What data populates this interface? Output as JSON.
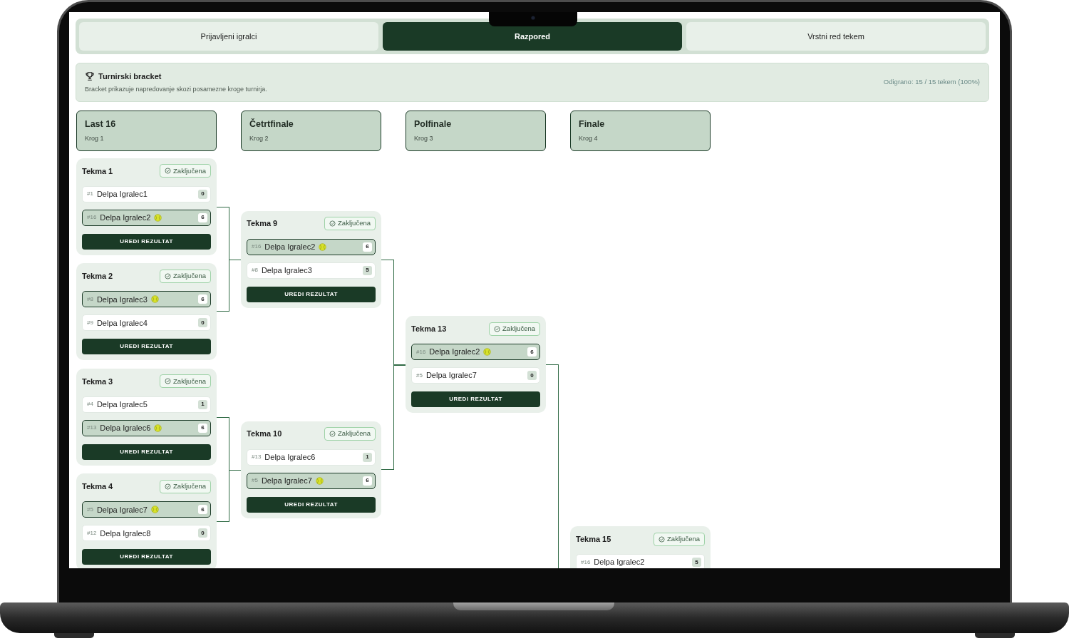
{
  "tabs": [
    {
      "label": "Prijavljeni igralci",
      "selected": false
    },
    {
      "label": "Razpored",
      "selected": true
    },
    {
      "label": "Vrstni red tekem",
      "selected": false
    }
  ],
  "bracket_panel": {
    "title": "Turnirski bracket",
    "description": "Bracket prikazuje napredovanje skozi posamezne kroge turnirja.",
    "progress": "Odigrano: 15 / 15 tekem (100%)"
  },
  "rounds": [
    {
      "title": "Last 16",
      "subtitle": "Krog 1",
      "matches": [
        {
          "title": "Tekma 1",
          "status": "Zaključena",
          "players": [
            {
              "seed": "#1",
              "name": "Delpa Igralec1",
              "score": "0",
              "winner": false
            },
            {
              "seed": "#16",
              "name": "Delpa Igralec2",
              "score": "6",
              "winner": true
            }
          ],
          "button": "UREDI REZULTAT"
        },
        {
          "title": "Tekma 2",
          "status": "Zaključena",
          "players": [
            {
              "seed": "#8",
              "name": "Delpa Igralec3",
              "score": "6",
              "winner": true
            },
            {
              "seed": "#9",
              "name": "Delpa Igralec4",
              "score": "0",
              "winner": false
            }
          ],
          "button": "UREDI REZULTAT"
        },
        {
          "title": "Tekma 3",
          "status": "Zaključena",
          "players": [
            {
              "seed": "#4",
              "name": "Delpa Igralec5",
              "score": "1",
              "winner": false
            },
            {
              "seed": "#13",
              "name": "Delpa Igralec6",
              "score": "6",
              "winner": true
            }
          ],
          "button": "UREDI REZULTAT"
        },
        {
          "title": "Tekma 4",
          "status": "Zaključena",
          "players": [
            {
              "seed": "#5",
              "name": "Delpa Igralec7",
              "score": "6",
              "winner": true
            },
            {
              "seed": "#12",
              "name": "Delpa Igralec8",
              "score": "0",
              "winner": false
            }
          ],
          "button": "UREDI REZULTAT"
        }
      ]
    },
    {
      "title": "Četrtfinale",
      "subtitle": "Krog 2",
      "matches": [
        {
          "title": "Tekma 9",
          "status": "Zaključena",
          "players": [
            {
              "seed": "#16",
              "name": "Delpa Igralec2",
              "score": "6",
              "winner": true
            },
            {
              "seed": "#8",
              "name": "Delpa Igralec3",
              "score": "5",
              "winner": false
            }
          ],
          "button": "UREDI REZULTAT"
        },
        {
          "title": "Tekma 10",
          "status": "Zaključena",
          "players": [
            {
              "seed": "#13",
              "name": "Delpa Igralec6",
              "score": "1",
              "winner": false
            },
            {
              "seed": "#5",
              "name": "Delpa Igralec7",
              "score": "6",
              "winner": true
            }
          ],
          "button": "UREDI REZULTAT"
        }
      ]
    },
    {
      "title": "Polfinale",
      "subtitle": "Krog 3",
      "matches": [
        {
          "title": "Tekma 13",
          "status": "Zaključena",
          "players": [
            {
              "seed": "#16",
              "name": "Delpa Igralec2",
              "score": "6",
              "winner": true
            },
            {
              "seed": "#5",
              "name": "Delpa Igralec7",
              "score": "0",
              "winner": false
            }
          ],
          "button": "UREDI REZULTAT"
        }
      ]
    },
    {
      "title": "Finale",
      "subtitle": "Krog 4",
      "matches": [
        {
          "title": "Tekma 15",
          "status": "Zaključena",
          "players": [
            {
              "seed": "#16",
              "name": "Delpa Igralec2",
              "score": "5",
              "winner": false
            }
          ]
        }
      ]
    }
  ]
}
